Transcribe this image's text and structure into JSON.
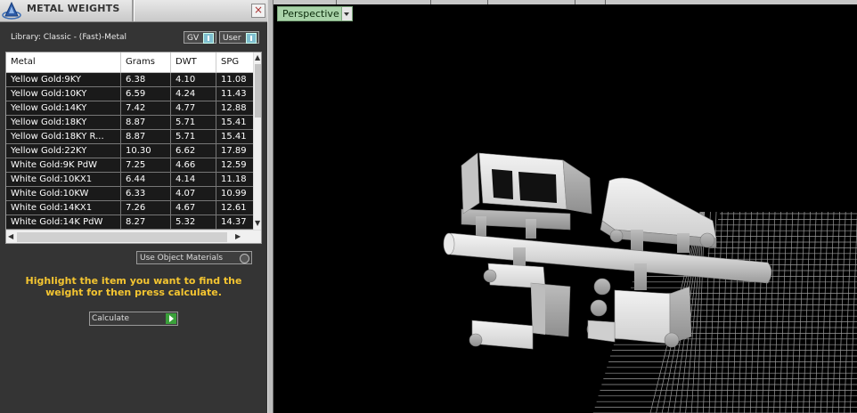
{
  "panel": {
    "title": "METAL WEIGHTS",
    "close_glyph": "×",
    "library_label": "Library: Classic - (Fast)-Metal",
    "toggles": {
      "gv": "GV",
      "user": "User"
    },
    "columns": [
      "Metal",
      "Grams",
      "DWT",
      "SPG"
    ],
    "rows": [
      [
        "Yellow Gold:9KY",
        "6.38",
        "4.10",
        "11.08"
      ],
      [
        "Yellow Gold:10KY",
        "6.59",
        "4.24",
        "11.43"
      ],
      [
        "Yellow Gold:14KY",
        "7.42",
        "4.77",
        "12.88"
      ],
      [
        "Yellow Gold:18KY",
        "8.87",
        "5.71",
        "15.41"
      ],
      [
        "Yellow Gold:18KY R...",
        "8.87",
        "5.71",
        "15.41"
      ],
      [
        "Yellow Gold:22KY",
        "10.30",
        "6.62",
        "17.89"
      ],
      [
        "White Gold:9K PdW",
        "7.25",
        "4.66",
        "12.59"
      ],
      [
        "White Gold:10KX1",
        "6.44",
        "4.14",
        "11.18"
      ],
      [
        "White Gold:10KW",
        "6.33",
        "4.07",
        "10.99"
      ],
      [
        "White Gold:14KX1",
        "7.26",
        "4.67",
        "12.61"
      ],
      [
        "White Gold:14K PdW",
        "8.27",
        "5.32",
        "14.37"
      ]
    ],
    "use_object_materials": "Use Object Materials",
    "instruction": "Highlight the item you want to find the weight for then press calculate.",
    "calculate_label": "Calculate"
  },
  "viewport": {
    "view_label": "Perspective"
  },
  "colors": {
    "panel_bg": "#343434",
    "instruction_text": "#f4c531",
    "view_tab": "#a9d3a9",
    "model": "#d9d9d9",
    "grid": "#9a9a9a"
  },
  "icons": {
    "logo": "app-logo-icon",
    "close": "close-icon",
    "toggle": "toggle-icon",
    "calculate": "play-arrow-icon",
    "dropdown": "chevron-down-icon"
  }
}
